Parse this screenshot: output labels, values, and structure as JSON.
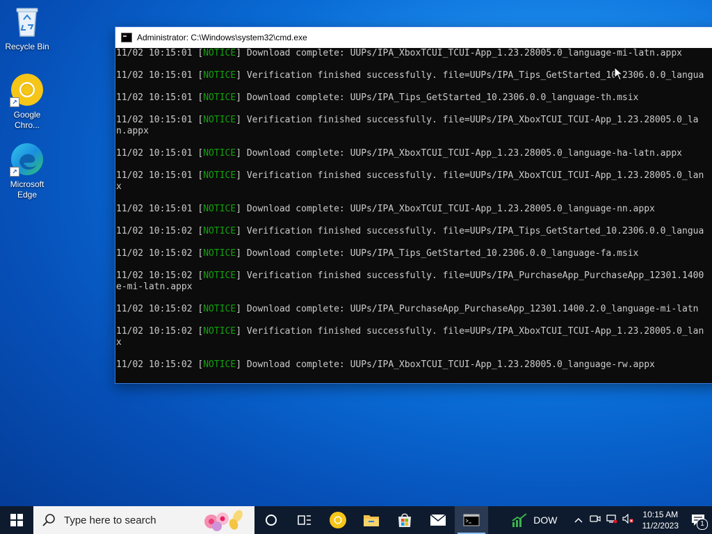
{
  "desktop": {
    "icons": [
      {
        "label": "Recycle Bin",
        "icon": "recycle-bin-icon"
      },
      {
        "label": "Google Chro...",
        "icon": "chrome-icon"
      },
      {
        "label": "Microsoft Edge",
        "icon": "edge-icon"
      }
    ]
  },
  "window": {
    "title": "Administrator: C:\\Windows\\system32\\cmd.exe"
  },
  "console": {
    "lines": [
      {
        "ts": "11/02 10:15:01",
        "tag": "NOTICE",
        "msg": "Download complete: UUPs/IPA_XboxTCUI_TCUI-App_1.23.28005.0_language-mi-latn.appx"
      },
      {
        "ts": "",
        "tag": "",
        "msg": ""
      },
      {
        "ts": "11/02 10:15:01",
        "tag": "NOTICE",
        "msg": "Verification finished successfully. file=UUPs/IPA_Tips_GetStarted_10.2306.0.0_langua"
      },
      {
        "ts": "",
        "tag": "",
        "msg": ""
      },
      {
        "ts": "11/02 10:15:01",
        "tag": "NOTICE",
        "msg": "Download complete: UUPs/IPA_Tips_GetStarted_10.2306.0.0_language-th.msix"
      },
      {
        "ts": "",
        "tag": "",
        "msg": ""
      },
      {
        "ts": "11/02 10:15:01",
        "tag": "NOTICE",
        "msg": "Verification finished successfully. file=UUPs/IPA_XboxTCUI_TCUI-App_1.23.28005.0_la"
      },
      {
        "ts": "",
        "tag": "",
        "msg": "n.appx"
      },
      {
        "ts": "",
        "tag": "",
        "msg": ""
      },
      {
        "ts": "11/02 10:15:01",
        "tag": "NOTICE",
        "msg": "Download complete: UUPs/IPA_XboxTCUI_TCUI-App_1.23.28005.0_language-ha-latn.appx"
      },
      {
        "ts": "",
        "tag": "",
        "msg": ""
      },
      {
        "ts": "11/02 10:15:01",
        "tag": "NOTICE",
        "msg": "Verification finished successfully. file=UUPs/IPA_XboxTCUI_TCUI-App_1.23.28005.0_lan"
      },
      {
        "ts": "",
        "tag": "",
        "msg": "x"
      },
      {
        "ts": "",
        "tag": "",
        "msg": ""
      },
      {
        "ts": "11/02 10:15:01",
        "tag": "NOTICE",
        "msg": "Download complete: UUPs/IPA_XboxTCUI_TCUI-App_1.23.28005.0_language-nn.appx"
      },
      {
        "ts": "",
        "tag": "",
        "msg": ""
      },
      {
        "ts": "11/02 10:15:02",
        "tag": "NOTICE",
        "msg": "Verification finished successfully. file=UUPs/IPA_Tips_GetStarted_10.2306.0.0_langua"
      },
      {
        "ts": "",
        "tag": "",
        "msg": ""
      },
      {
        "ts": "11/02 10:15:02",
        "tag": "NOTICE",
        "msg": "Download complete: UUPs/IPA_Tips_GetStarted_10.2306.0.0_language-fa.msix"
      },
      {
        "ts": "",
        "tag": "",
        "msg": ""
      },
      {
        "ts": "11/02 10:15:02",
        "tag": "NOTICE",
        "msg": "Verification finished successfully. file=UUPs/IPA_PurchaseApp_PurchaseApp_12301.1400"
      },
      {
        "ts": "",
        "tag": "",
        "msg": "e-mi-latn.appx"
      },
      {
        "ts": "",
        "tag": "",
        "msg": ""
      },
      {
        "ts": "11/02 10:15:02",
        "tag": "NOTICE",
        "msg": "Download complete: UUPs/IPA_PurchaseApp_PurchaseApp_12301.1400.2.0_language-mi-latn"
      },
      {
        "ts": "",
        "tag": "",
        "msg": ""
      },
      {
        "ts": "11/02 10:15:02",
        "tag": "NOTICE",
        "msg": "Verification finished successfully. file=UUPs/IPA_XboxTCUI_TCUI-App_1.23.28005.0_lan"
      },
      {
        "ts": "",
        "tag": "",
        "msg": "x"
      },
      {
        "ts": "",
        "tag": "",
        "msg": ""
      },
      {
        "ts": "11/02 10:15:02",
        "tag": "NOTICE",
        "msg": "Download complete: UUPs/IPA_XboxTCUI_TCUI-App_1.23.28005.0_language-rw.appx"
      },
      {
        "ts": "",
        "tag": "",
        "msg": ""
      }
    ]
  },
  "taskbar": {
    "search_placeholder": "Type here to search",
    "stock_label": "DOW",
    "clock_time": "10:15 AM",
    "clock_date": "11/2/2023",
    "notification_count": "1"
  },
  "colors": {
    "notice": "#13a10e",
    "console_text": "#cccccc",
    "console_bg": "#0c0c0c",
    "taskbar_bg": "#0e1b2e"
  }
}
